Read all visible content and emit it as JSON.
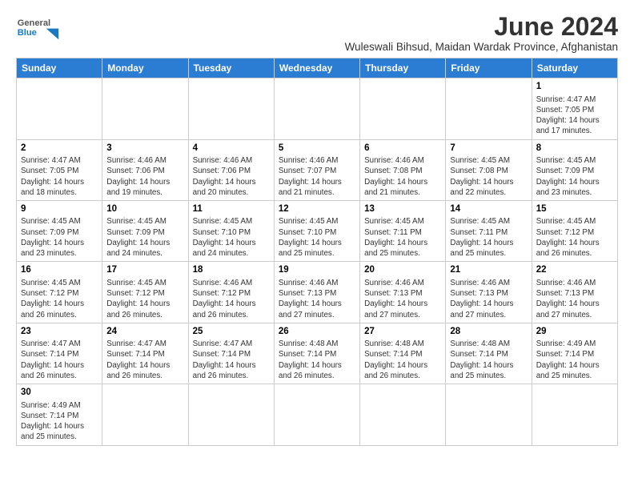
{
  "header": {
    "logo_general": "General",
    "logo_blue": "Blue",
    "month": "June 2024",
    "subtitle": "Wuleswali Bihsud, Maidan Wardak Province, Afghanistan"
  },
  "weekdays": [
    "Sunday",
    "Monday",
    "Tuesday",
    "Wednesday",
    "Thursday",
    "Friday",
    "Saturday"
  ],
  "weeks": [
    [
      {
        "day": "",
        "info": ""
      },
      {
        "day": "",
        "info": ""
      },
      {
        "day": "",
        "info": ""
      },
      {
        "day": "",
        "info": ""
      },
      {
        "day": "",
        "info": ""
      },
      {
        "day": "",
        "info": ""
      },
      {
        "day": "1",
        "info": "Sunrise: 4:47 AM\nSunset: 7:05 PM\nDaylight: 14 hours and 17 minutes."
      }
    ],
    [
      {
        "day": "2",
        "info": "Sunrise: 4:47 AM\nSunset: 7:05 PM\nDaylight: 14 hours and 18 minutes."
      },
      {
        "day": "3",
        "info": "Sunrise: 4:46 AM\nSunset: 7:06 PM\nDaylight: 14 hours and 19 minutes."
      },
      {
        "day": "4",
        "info": "Sunrise: 4:46 AM\nSunset: 7:06 PM\nDaylight: 14 hours and 20 minutes."
      },
      {
        "day": "5",
        "info": "Sunrise: 4:46 AM\nSunset: 7:07 PM\nDaylight: 14 hours and 21 minutes."
      },
      {
        "day": "6",
        "info": "Sunrise: 4:46 AM\nSunset: 7:08 PM\nDaylight: 14 hours and 21 minutes."
      },
      {
        "day": "7",
        "info": "Sunrise: 4:45 AM\nSunset: 7:08 PM\nDaylight: 14 hours and 22 minutes."
      },
      {
        "day": "8",
        "info": "Sunrise: 4:45 AM\nSunset: 7:09 PM\nDaylight: 14 hours and 23 minutes."
      }
    ],
    [
      {
        "day": "9",
        "info": "Sunrise: 4:45 AM\nSunset: 7:09 PM\nDaylight: 14 hours and 23 minutes."
      },
      {
        "day": "10",
        "info": "Sunrise: 4:45 AM\nSunset: 7:09 PM\nDaylight: 14 hours and 24 minutes."
      },
      {
        "day": "11",
        "info": "Sunrise: 4:45 AM\nSunset: 7:10 PM\nDaylight: 14 hours and 24 minutes."
      },
      {
        "day": "12",
        "info": "Sunrise: 4:45 AM\nSunset: 7:10 PM\nDaylight: 14 hours and 25 minutes."
      },
      {
        "day": "13",
        "info": "Sunrise: 4:45 AM\nSunset: 7:11 PM\nDaylight: 14 hours and 25 minutes."
      },
      {
        "day": "14",
        "info": "Sunrise: 4:45 AM\nSunset: 7:11 PM\nDaylight: 14 hours and 25 minutes."
      },
      {
        "day": "15",
        "info": "Sunrise: 4:45 AM\nSunset: 7:12 PM\nDaylight: 14 hours and 26 minutes."
      }
    ],
    [
      {
        "day": "16",
        "info": "Sunrise: 4:45 AM\nSunset: 7:12 PM\nDaylight: 14 hours and 26 minutes."
      },
      {
        "day": "17",
        "info": "Sunrise: 4:45 AM\nSunset: 7:12 PM\nDaylight: 14 hours and 26 minutes."
      },
      {
        "day": "18",
        "info": "Sunrise: 4:46 AM\nSunset: 7:12 PM\nDaylight: 14 hours and 26 minutes."
      },
      {
        "day": "19",
        "info": "Sunrise: 4:46 AM\nSunset: 7:13 PM\nDaylight: 14 hours and 27 minutes."
      },
      {
        "day": "20",
        "info": "Sunrise: 4:46 AM\nSunset: 7:13 PM\nDaylight: 14 hours and 27 minutes."
      },
      {
        "day": "21",
        "info": "Sunrise: 4:46 AM\nSunset: 7:13 PM\nDaylight: 14 hours and 27 minutes."
      },
      {
        "day": "22",
        "info": "Sunrise: 4:46 AM\nSunset: 7:13 PM\nDaylight: 14 hours and 27 minutes."
      }
    ],
    [
      {
        "day": "23",
        "info": "Sunrise: 4:47 AM\nSunset: 7:14 PM\nDaylight: 14 hours and 26 minutes."
      },
      {
        "day": "24",
        "info": "Sunrise: 4:47 AM\nSunset: 7:14 PM\nDaylight: 14 hours and 26 minutes."
      },
      {
        "day": "25",
        "info": "Sunrise: 4:47 AM\nSunset: 7:14 PM\nDaylight: 14 hours and 26 minutes."
      },
      {
        "day": "26",
        "info": "Sunrise: 4:48 AM\nSunset: 7:14 PM\nDaylight: 14 hours and 26 minutes."
      },
      {
        "day": "27",
        "info": "Sunrise: 4:48 AM\nSunset: 7:14 PM\nDaylight: 14 hours and 26 minutes."
      },
      {
        "day": "28",
        "info": "Sunrise: 4:48 AM\nSunset: 7:14 PM\nDaylight: 14 hours and 25 minutes."
      },
      {
        "day": "29",
        "info": "Sunrise: 4:49 AM\nSunset: 7:14 PM\nDaylight: 14 hours and 25 minutes."
      }
    ],
    [
      {
        "day": "30",
        "info": "Sunrise: 4:49 AM\nSunset: 7:14 PM\nDaylight: 14 hours and 25 minutes."
      },
      {
        "day": "",
        "info": ""
      },
      {
        "day": "",
        "info": ""
      },
      {
        "day": "",
        "info": ""
      },
      {
        "day": "",
        "info": ""
      },
      {
        "day": "",
        "info": ""
      },
      {
        "day": "",
        "info": ""
      }
    ]
  ]
}
